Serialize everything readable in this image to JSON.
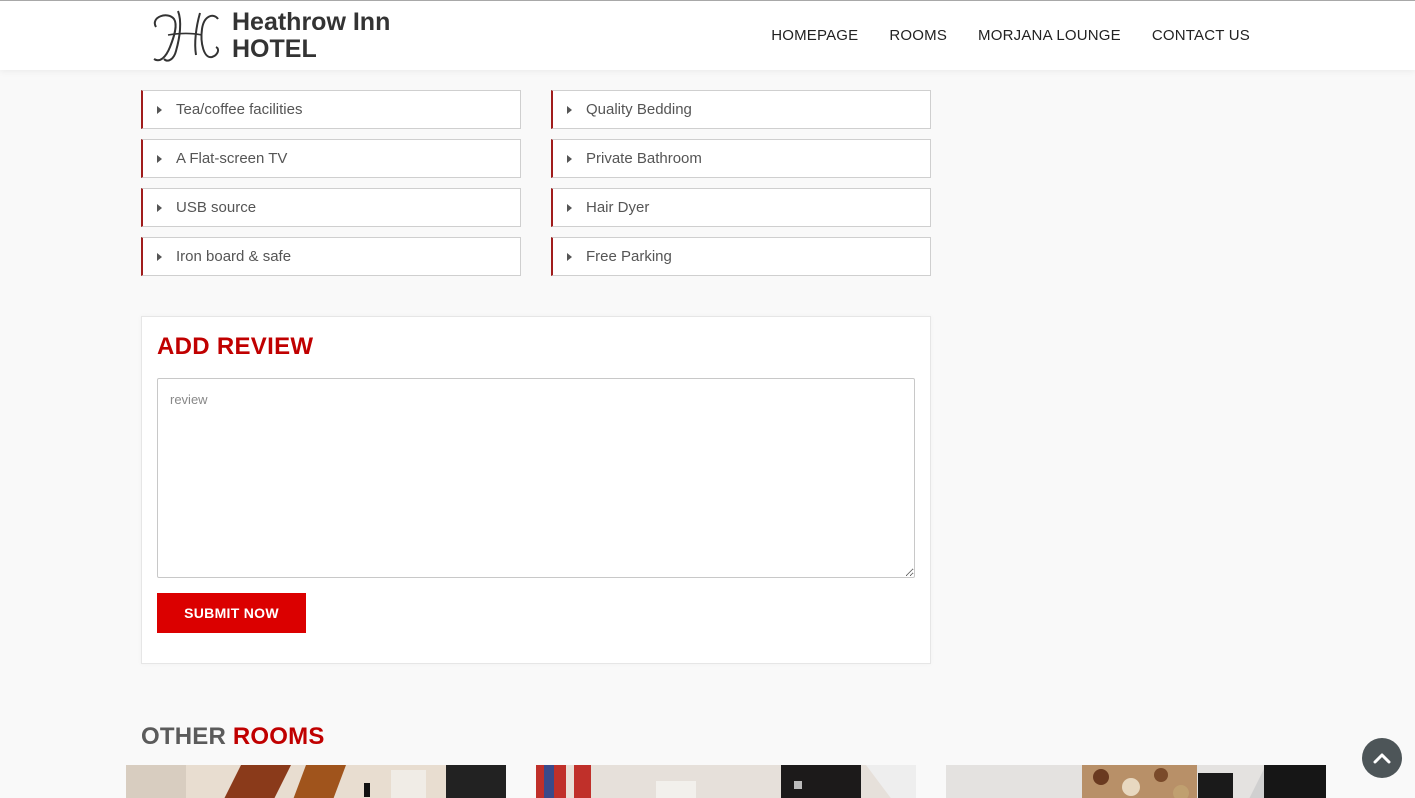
{
  "header": {
    "logo": {
      "monogram": "HC",
      "line1": "Heathrow Inn",
      "line2": "HOTEL"
    },
    "nav": [
      {
        "label": "HOMEPAGE"
      },
      {
        "label": "ROOMS"
      },
      {
        "label": "MORJANA LOUNGE"
      },
      {
        "label": "CONTACT US"
      }
    ]
  },
  "features": [
    {
      "label": "Tea/coffee facilities",
      "icon": "caret-right-icon"
    },
    {
      "label": "Quality Bedding",
      "icon": "caret-right-icon"
    },
    {
      "label": "A Flat-screen TV",
      "icon": "caret-right-icon"
    },
    {
      "label": "Private Bathroom",
      "icon": "caret-right-icon"
    },
    {
      "label": "USB source",
      "icon": "caret-right-icon"
    },
    {
      "label": "Hair Dyer",
      "icon": "caret-right-icon"
    },
    {
      "label": "Iron board & safe",
      "icon": "caret-right-icon"
    },
    {
      "label": "Free Parking",
      "icon": "caret-right-icon"
    }
  ],
  "review": {
    "title": "ADD REVIEW",
    "placeholder": "review",
    "value": "",
    "submit_label": "SUBMIT NOW"
  },
  "other_rooms": {
    "title_part1": "OTHER",
    "title_part2": "ROOMS",
    "cards": [
      {
        "image": "room-photo-1"
      },
      {
        "image": "room-photo-2"
      },
      {
        "image": "room-photo-3"
      }
    ]
  },
  "scroll_top": {
    "icon": "chevron-up-icon"
  },
  "colors": {
    "accent": "#c00000",
    "button": "#db0000",
    "feature_border": "#a01c1c",
    "scroll_top_bg": "#4d5558"
  }
}
